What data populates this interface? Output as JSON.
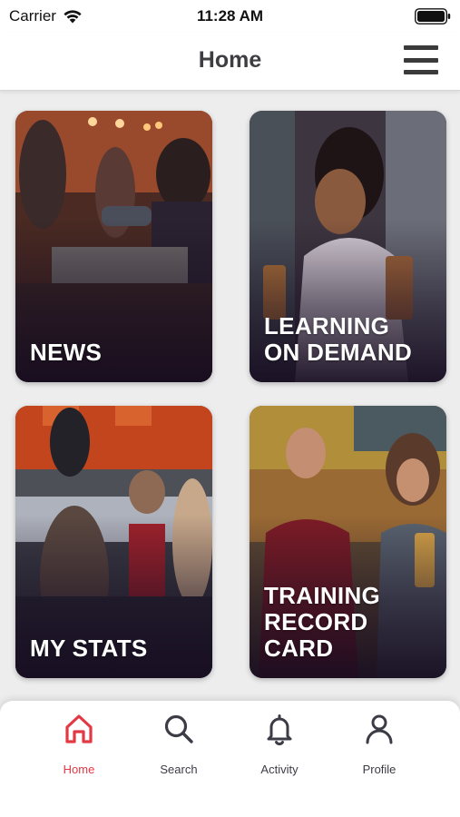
{
  "status_bar": {
    "carrier": "Carrier",
    "time": "11:28 AM"
  },
  "header": {
    "title": "Home",
    "menu_icon": "hamburger-menu-icon"
  },
  "tiles": [
    {
      "label": "NEWS"
    },
    {
      "label": "LEARNING\nON DEMAND"
    },
    {
      "label": "MY STATS"
    },
    {
      "label": "TRAINING\nRECORD\nCARD"
    }
  ],
  "tabbar": {
    "accent_color": "#e33945",
    "inactive_color": "#3c3c46",
    "items": [
      {
        "label": "Home",
        "icon": "home-icon",
        "active": true
      },
      {
        "label": "Search",
        "icon": "search-icon",
        "active": false
      },
      {
        "label": "Activity",
        "icon": "bell-icon",
        "active": false
      },
      {
        "label": "Profile",
        "icon": "person-icon",
        "active": false
      }
    ]
  }
}
